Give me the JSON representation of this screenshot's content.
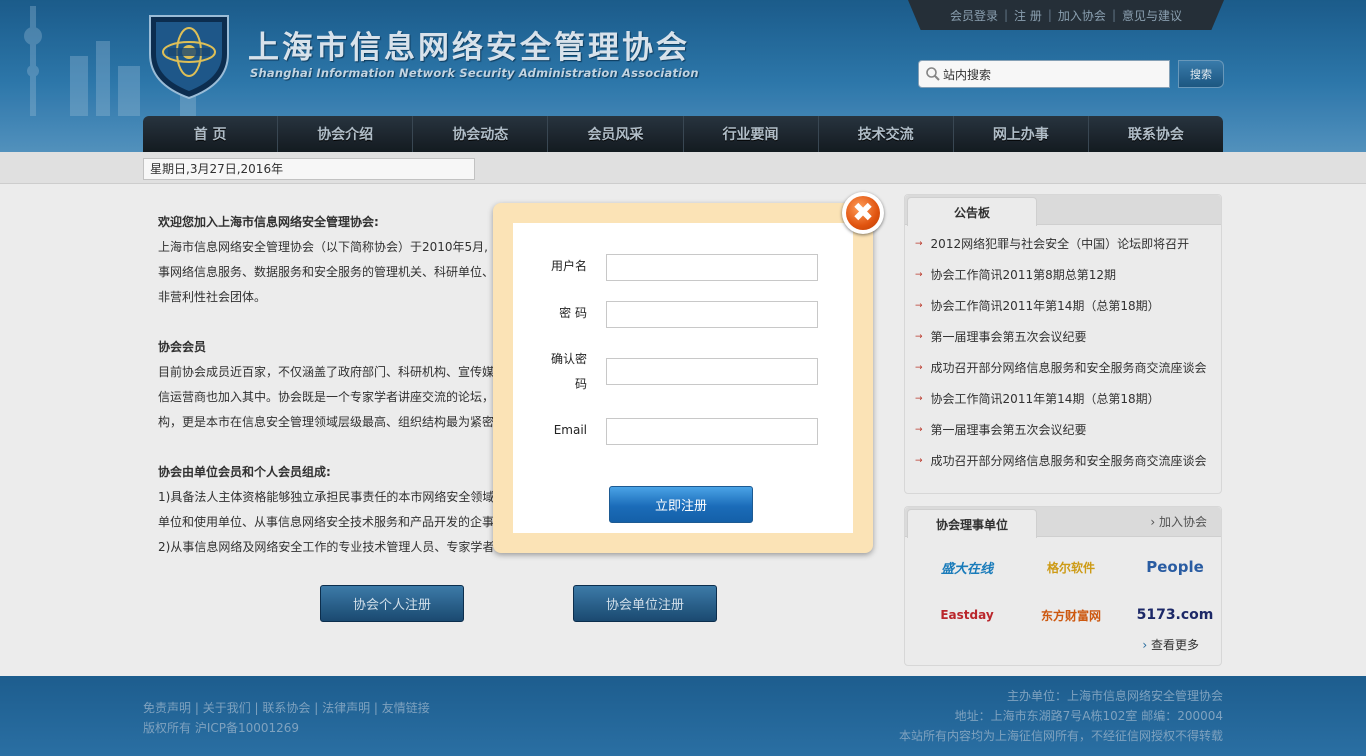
{
  "header": {
    "title_cn": "上海市信息网络安全管理协会",
    "title_en": "Shanghai Information Network Security Administration Association",
    "top_links": [
      "会员登录",
      "注 册",
      "加入协会",
      "意见与建议"
    ],
    "search": {
      "placeholder": "站内搜索",
      "value": "站内搜索",
      "button": "搜索"
    }
  },
  "nav": [
    "首 页",
    "协会介绍",
    "协会动态",
    "会员风采",
    "行业要闻",
    "技术交流",
    "网上办事",
    "联系协会"
  ],
  "date_text": "星期日,3月27日,2016年",
  "content": {
    "welcome_title": "欢迎您加入上海市信息网络安全管理协会:",
    "intro_lines": [
      "上海市信息网络安全管理协会（以下简称协会）于2010年5月,",
      "事网络信息服务、数据服务和安全服务的管理机关、科研单位、",
      "非营利性社会团体。"
    ],
    "members_title": "协会会员",
    "members_lines": [
      "目前协会成员近百家，不仅涵盖了政府部门、科研机构、宣传媒",
      "信运营商也加入其中。协会既是一个专家学者讲座交流的论坛，",
      "构，更是本市在信息安全管理领域层级最高、组织结构最为紧密"
    ],
    "composition_title": "协会由单位会员和个人会员组成:",
    "composition_lines": [
      "1)具备法人主体资格能够独立承担民事责任的本市网络安全领域",
      "单位和使用单位、从事信息网络安全技术服务和产品开发的企事",
      "2)从事信息网络及网络安全工作的专业技术管理人员、专家学者"
    ],
    "btn_personal": "协会个人注册",
    "btn_unit": "协会单位注册"
  },
  "notice": {
    "tab": "公告板",
    "items": [
      "2012网络犯罪与社会安全（中国）论坛即将召开",
      "协会工作简讯2011第8期总第12期",
      "协会工作简讯2011年第14期（总第18期）",
      "第一届理事会第五次会议纪要",
      "成功召开部分网络信息服务和安全服务商交流座谈会",
      "协会工作简讯2011年第14期（总第18期）",
      "第一届理事会第五次会议纪要",
      "成功召开部分网络信息服务和安全服务商交流座谈会"
    ]
  },
  "council": {
    "tab": "协会理事单位",
    "join": "加入协会",
    "logos": [
      "盛大在线",
      "格尔软件",
      "People",
      "Eastday",
      "东方财富网",
      "5173.com"
    ],
    "more": "查看更多"
  },
  "footer": {
    "links": [
      "免责声明",
      "关于我们",
      "联系协会",
      "法律声明",
      "友情链接"
    ],
    "copyright": "版权所有 沪ICP备10001269",
    "host": "主办单位：上海市信息网络安全管理协会",
    "address": "地址：上海市东湖路7号A栋102室 邮编：200004",
    "rights": "本站所有内容均为上海征信网所有，不经征信网授权不得转载"
  },
  "modal": {
    "username_label": "用户名",
    "password_label": "密 码",
    "confirm_label_1": "确认密",
    "confirm_label_2": "码",
    "email_label": "Email",
    "submit": "立即注册",
    "close": "✖"
  },
  "colors": {
    "accent": "#2a6fa3",
    "modal_border": "#fbe3b6",
    "close": "#e0530f"
  }
}
